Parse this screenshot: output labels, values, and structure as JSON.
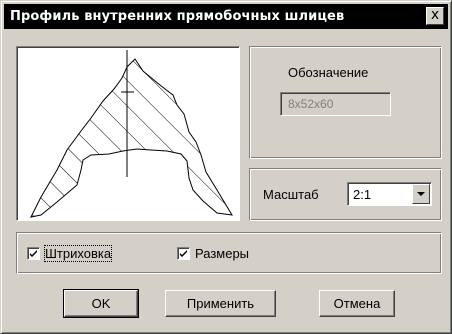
{
  "dialog": {
    "title": "Профиль внутренних прямобочных шлицев",
    "close_label": "x"
  },
  "designation": {
    "label": "Обозначение",
    "value": "8x52x60"
  },
  "scale": {
    "label": "Масштаб",
    "value": "2:1"
  },
  "options": {
    "hatching_label": "Штриховка",
    "hatching_checked": true,
    "dimensions_label": "Размеры",
    "dimensions_checked": true
  },
  "buttons": {
    "ok": "OK",
    "apply": "Применить",
    "cancel": "Отмена"
  },
  "icons": {
    "close": "close-icon",
    "dropdown": "chevron-down-icon",
    "check": "check-icon"
  }
}
